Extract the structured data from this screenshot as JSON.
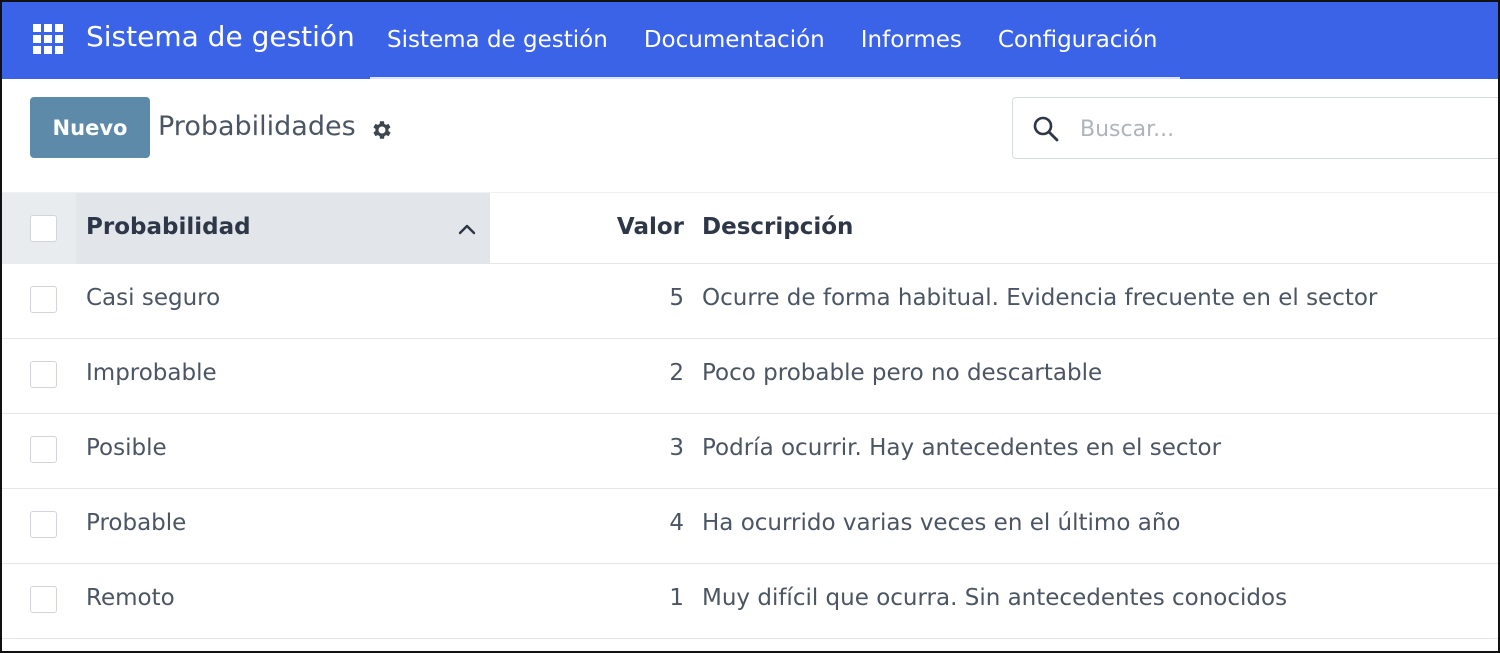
{
  "navbar": {
    "brand": "Sistema de gestión",
    "items": [
      "Sistema de gestión",
      "Documentación",
      "Informes",
      "Configuración"
    ],
    "color": "#3a63e8"
  },
  "control": {
    "new_label": "Nuevo",
    "title": "Probabilidades",
    "search_placeholder": "Buscar..."
  },
  "table": {
    "columns": {
      "probability": "Probabilidad",
      "value": "Valor",
      "description": "Descripción"
    },
    "rows": [
      {
        "probability": "Casi seguro",
        "value": "5",
        "description": "Ocurre de forma habitual. Evidencia frecuente en el sector"
      },
      {
        "probability": "Improbable",
        "value": "2",
        "description": "Poco probable pero no descartable"
      },
      {
        "probability": "Posible",
        "value": "3",
        "description": "Podría ocurrir. Hay antecedentes en el sector"
      },
      {
        "probability": "Probable",
        "value": "4",
        "description": "Ha ocurrido varias veces en el último año"
      },
      {
        "probability": "Remoto",
        "value": "1",
        "description": "Muy difícil que ocurra. Sin antecedentes conocidos"
      }
    ]
  },
  "icons": {
    "apps": "apps-grid-icon",
    "gear": "gear-icon",
    "search": "search-icon",
    "sort": "chevron-up-icon"
  }
}
